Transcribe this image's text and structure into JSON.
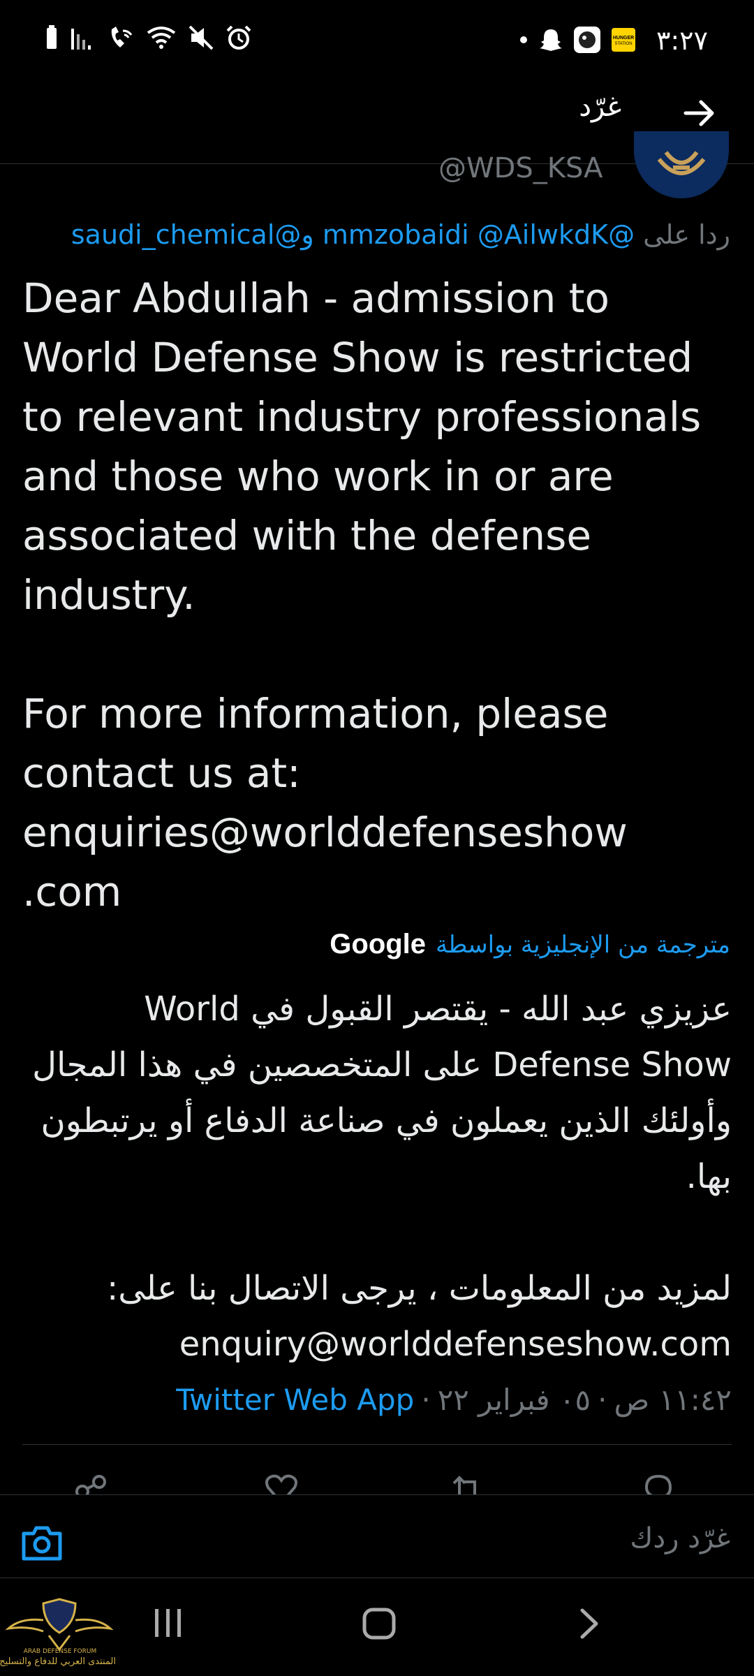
{
  "status_bar": {
    "time": "٣:٢٧",
    "right_icons": [
      "dot-icon",
      "snapchat-icon",
      "app-icon",
      "hungerstation-icon"
    ],
    "left_icons": [
      "battery-icon",
      "signal-icon",
      "wifi-call-icon",
      "wifi-icon",
      "mute-icon",
      "alarm-icon"
    ]
  },
  "header": {
    "title": "غرّد"
  },
  "author": {
    "handle": "@WDS_KSA"
  },
  "reply_to": {
    "label": "ردا على",
    "mention1": "@mmzobaidi",
    "mention2": "@AilwkdK",
    "conjunction": "و",
    "mention3": "@saudi_chemical"
  },
  "tweet": {
    "text": "Dear Abdullah - admission to\nWorld Defense Show is restricted\nto relevant industry professionals\nand those who work in or are\nassociated with the defense\nindustry.\n\nFor more information, please\ncontact us at:\nenquiries@worlddefenseshow\n.com"
  },
  "translation": {
    "label": "مترجمة من الإنجليزية بواسطة",
    "provider": "Google",
    "text": "عزيزي عبد الله - يقتصر القبول في World\nDefense Show على المتخصصين في هذا المجال\nوأولئك الذين يعملون في صناعة الدفاع أو يرتبطون\nبها.\n\nلمزيد من المعلومات ، يرجى الاتصال بنا على:\nenquiry@worlddefenseshow.com"
  },
  "meta": {
    "time": "١١:٤٢ ص",
    "date": "٠٥ فبراير ٢٢",
    "source": "Twitter Web App"
  },
  "composer": {
    "placeholder": "غرّد ردك"
  },
  "watermark": {
    "text": "المنتدى العربي للدفاع والتسليح",
    "text_en": "ARAB DEFENSE FORUM"
  },
  "colors": {
    "background": "#000000",
    "text": "#e7e9ea",
    "secondary": "#71767b",
    "link": "#1d9bf0",
    "divider": "#2f3336"
  }
}
